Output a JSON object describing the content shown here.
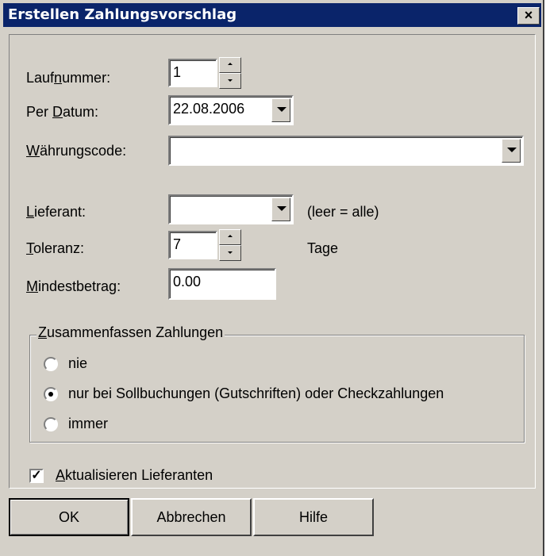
{
  "window": {
    "title": "Erstellen Zahlungsvorschlag",
    "close_glyph": "×"
  },
  "fields": {
    "laufnummer": {
      "label_pre": "Lauf",
      "label_key": "n",
      "label_post": "ummer:",
      "value": "1"
    },
    "per_datum": {
      "label_pre": "Per ",
      "label_key": "D",
      "label_post": "atum:",
      "value": "22.08.2006"
    },
    "waehrungscode": {
      "label_pre": "",
      "label_key": "W",
      "label_post": "ährungscode:",
      "value": ""
    },
    "lieferant": {
      "label_pre": "",
      "label_key": "L",
      "label_post": "ieferant:",
      "value": "",
      "hint": "(leer = alle)"
    },
    "toleranz": {
      "label_pre": "",
      "label_key": "T",
      "label_post": "oleranz:",
      "value": "7",
      "unit": "Tage"
    },
    "mindestbetrag": {
      "label_pre": "",
      "label_key": "M",
      "label_post": "indestbetrag:",
      "value": "0.00"
    }
  },
  "group": {
    "legend_key": "Z",
    "legend_post": "usammenfassen Zahlungen",
    "options": [
      {
        "label": "nie",
        "selected": false
      },
      {
        "label": "nur bei Sollbuchungen (Gutschriften) oder Checkzahlungen",
        "selected": true
      },
      {
        "label": "immer",
        "selected": false
      }
    ]
  },
  "checkbox": {
    "label_key": "A",
    "label_post": "ktualisieren Lieferanten",
    "checked": true
  },
  "buttons": {
    "ok": "OK",
    "cancel": "Abbrechen",
    "help": "Hilfe"
  }
}
